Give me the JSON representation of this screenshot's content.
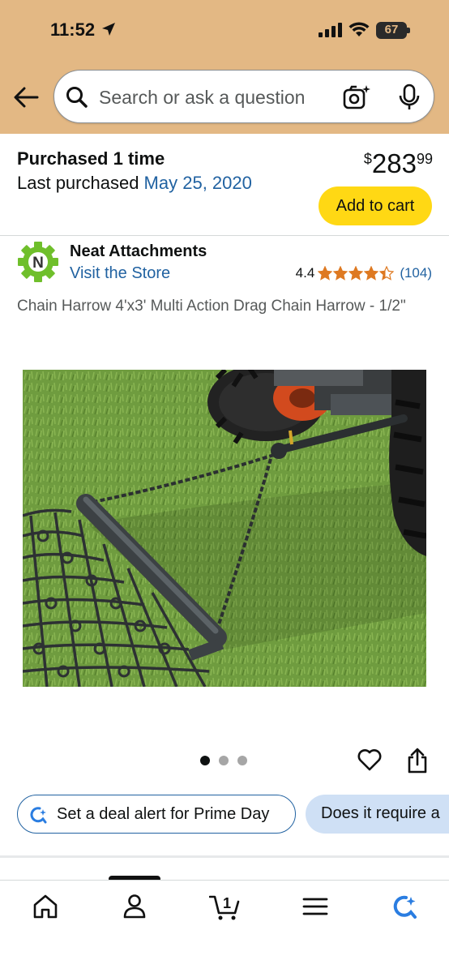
{
  "status_bar": {
    "time": "11:52",
    "battery": "67"
  },
  "search": {
    "placeholder": "Search or ask a question"
  },
  "purchase": {
    "times_label": "Purchased 1 time",
    "last_label": "Last purchased ",
    "last_date": "May 25, 2020",
    "price_currency": "$",
    "price_whole": "283",
    "price_fraction": "99",
    "add_to_cart": "Add to cart"
  },
  "store": {
    "logo_letter": "N",
    "name": "Neat Attachments",
    "visit_label": "Visit the Store",
    "rating_value": "4.4",
    "rating_stars": 4.4,
    "rating_count": "(104)"
  },
  "product": {
    "title": "Chain Harrow 4'x3' Multi Action Drag Chain Harrow - 1/2\"",
    "image_count": 3,
    "active_image": 1
  },
  "chips": {
    "deal_alert": "Set a deal alert for Prime Day",
    "question": "Does it require a"
  },
  "bottom_nav": {
    "items": [
      "home-icon",
      "account-icon",
      "cart-icon",
      "menu-icon",
      "rufus-icon"
    ],
    "cart_count": "1"
  },
  "colors": {
    "header_bg": "#e3b884",
    "link": "#2162a1",
    "add_to_cart_bg": "#ffd814",
    "star": "#de7921",
    "store_logo_green": "#6fbf2b"
  }
}
